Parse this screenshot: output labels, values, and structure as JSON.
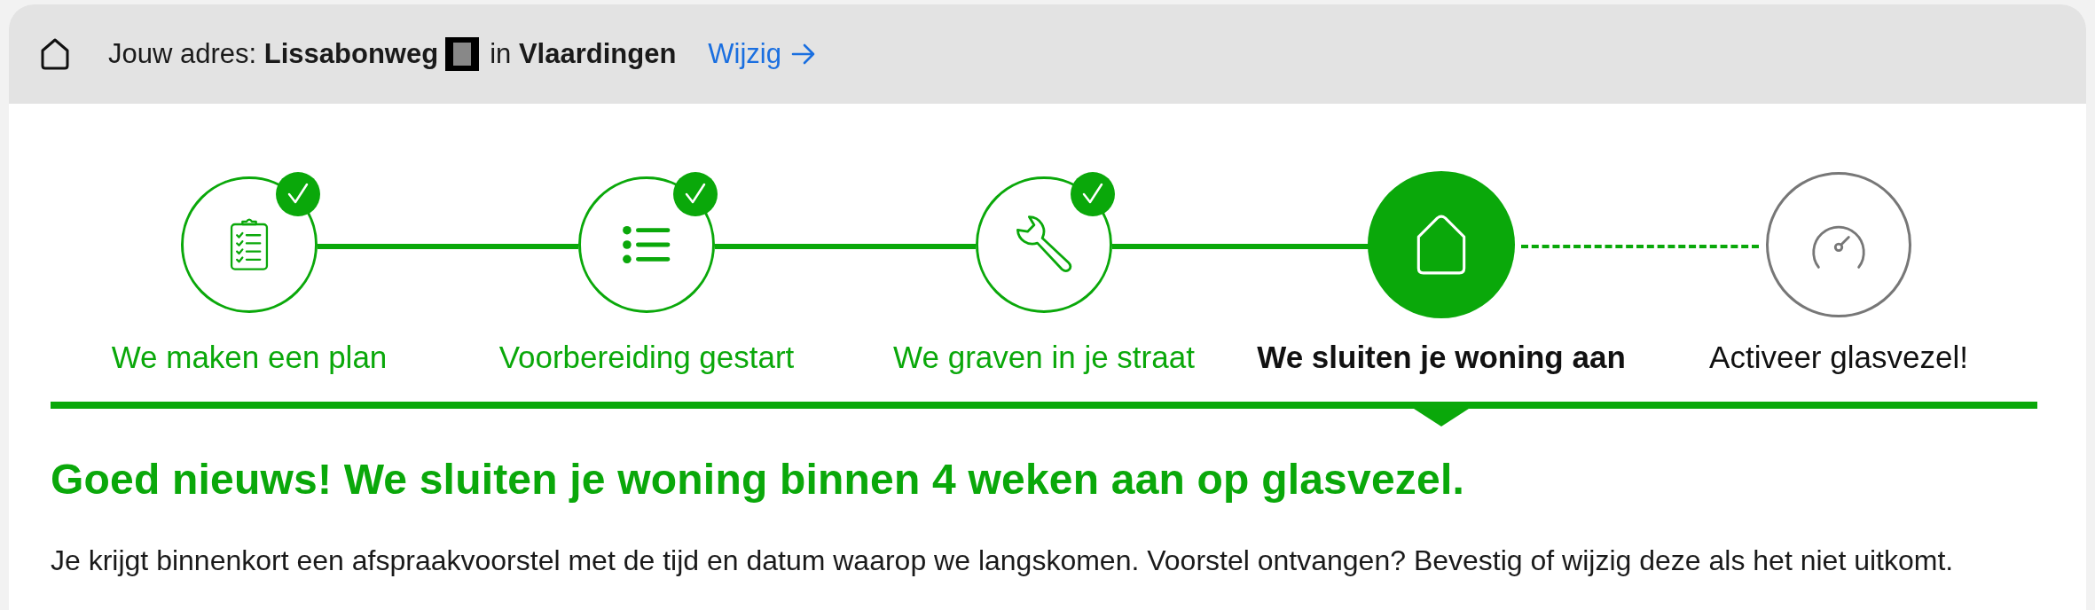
{
  "address_bar": {
    "prefix": "Jouw adres:",
    "street": "Lissabonweg",
    "redacted": true,
    "separator": "in",
    "city": "Vlaardingen",
    "change_link": "Wijzig"
  },
  "steps": [
    {
      "label": "We maken een plan",
      "kind": "done"
    },
    {
      "label": "Voorbereiding gestart",
      "kind": "done"
    },
    {
      "label": "We graven in je straat",
      "kind": "done"
    },
    {
      "label": "We sluiten je woning aan",
      "kind": "current"
    },
    {
      "label": "Activeer glasvezel!",
      "kind": "upcoming"
    }
  ],
  "heading": "Goed nieuws! We sluiten je woning binnen 4 weken aan op glasvezel.",
  "body": "Je krijgt binnenkort een afspraakvoorstel met de tijd en datum waarop we langskomen. Voorstel ontvangen? Bevestig of wijzig deze als het niet uitkomt."
}
